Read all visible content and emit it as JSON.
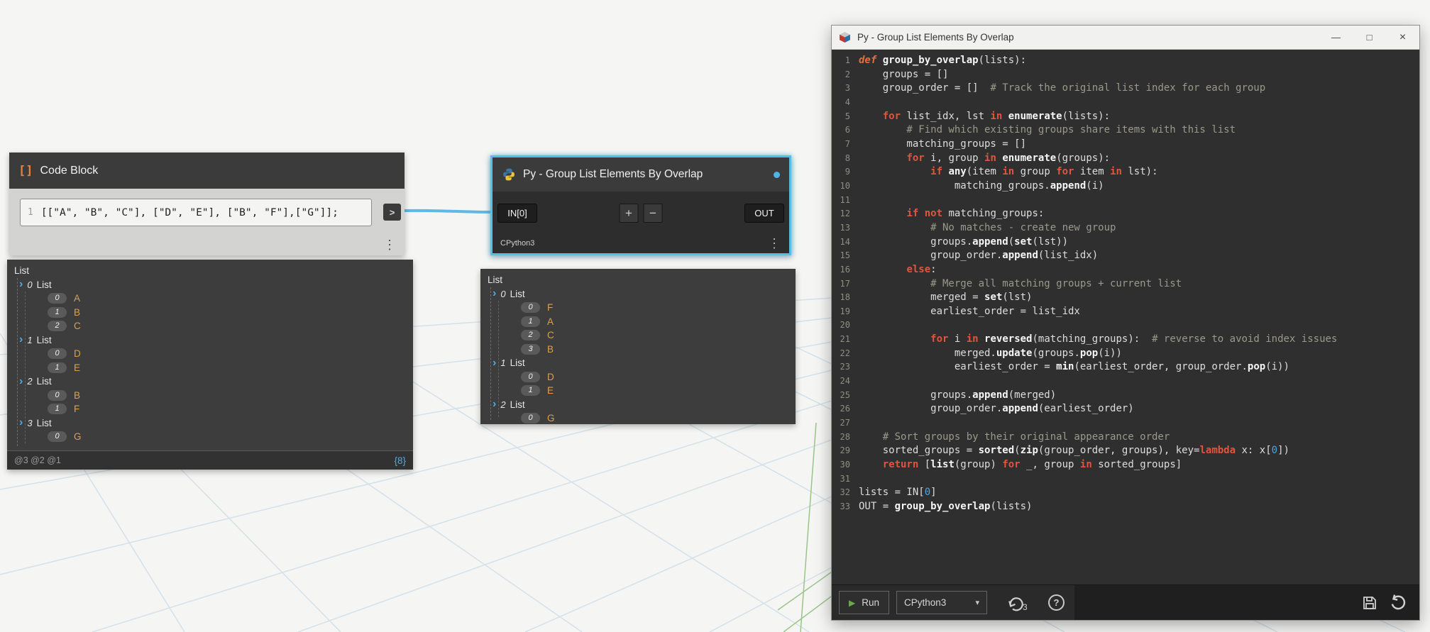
{
  "canvas": {
    "bg": "#f5f5f3",
    "grid_color": "#d3e1ea",
    "axis_color": "#9ac489",
    "wire_color": "#5fb8e6",
    "selection_color": "#58bce8"
  },
  "icons": {
    "tree_chevron": "›",
    "caret_down": "▾",
    "play": "▶",
    "menu": "⋮",
    "value_accent": "#d9a24a"
  },
  "code_block_node": {
    "title": "Code Block",
    "icon": "[]",
    "line_number": "1",
    "code": "[[\"A\", \"B\", \"C\"], [\"D\", \"E\"], [\"B\", \"F\"],[\"G\"]];",
    "output_chevron": ">"
  },
  "python_node": {
    "title": "Py - Group List Elements By Overlap",
    "engine": "CPython3",
    "input_port": "IN[0]",
    "add_label": "+",
    "remove_label": "−",
    "output_port": "OUT"
  },
  "preview_left": {
    "rows": [
      {
        "t": "root",
        "label": "List"
      },
      {
        "t": "list",
        "idx": "0",
        "label": "List"
      },
      {
        "t": "item",
        "idx": "0",
        "val": "A"
      },
      {
        "t": "item",
        "idx": "1",
        "val": "B"
      },
      {
        "t": "item",
        "idx": "2",
        "val": "C"
      },
      {
        "t": "list",
        "idx": "1",
        "label": "List"
      },
      {
        "t": "item",
        "idx": "0",
        "val": "D"
      },
      {
        "t": "item",
        "idx": "1",
        "val": "E"
      },
      {
        "t": "list",
        "idx": "2",
        "label": "List"
      },
      {
        "t": "item",
        "idx": "0",
        "val": "B"
      },
      {
        "t": "item",
        "idx": "1",
        "val": "F"
      },
      {
        "t": "list",
        "idx": "3",
        "label": "List"
      },
      {
        "t": "item",
        "idx": "0",
        "val": "G"
      }
    ],
    "footer_levels": "@3 @2 @1",
    "footer_count": "{8}"
  },
  "preview_right": {
    "rows": [
      {
        "t": "root",
        "label": "List"
      },
      {
        "t": "list",
        "idx": "0",
        "label": "List"
      },
      {
        "t": "item",
        "idx": "0",
        "val": "F"
      },
      {
        "t": "item",
        "idx": "1",
        "val": "A"
      },
      {
        "t": "item",
        "idx": "2",
        "val": "C"
      },
      {
        "t": "item",
        "idx": "3",
        "val": "B"
      },
      {
        "t": "list",
        "idx": "1",
        "label": "List"
      },
      {
        "t": "item",
        "idx": "0",
        "val": "D"
      },
      {
        "t": "item",
        "idx": "1",
        "val": "E"
      },
      {
        "t": "list",
        "idx": "2",
        "label": "List"
      },
      {
        "t": "item",
        "idx": "0",
        "val": "G"
      }
    ]
  },
  "editor": {
    "title": "Py - Group List Elements By Overlap",
    "window": {
      "minimize": "—",
      "maximize": "□",
      "close": "×"
    },
    "toolbar": {
      "run": "Run",
      "engine": "CPython3",
      "migration": "3",
      "help": "?"
    },
    "lines": [
      {
        "n": "1",
        "seg": [
          [
            "kwi",
            "def"
          ],
          [
            "pl",
            " "
          ],
          [
            "fn",
            "group_by_overlap"
          ],
          [
            "pl",
            "(lists):"
          ]
        ]
      },
      {
        "n": "2",
        "seg": [
          [
            "pl",
            "    groups = []"
          ]
        ]
      },
      {
        "n": "3",
        "seg": [
          [
            "pl",
            "    group_order = []  "
          ],
          [
            "com",
            "# Track the original list index for each group"
          ]
        ]
      },
      {
        "n": "4",
        "seg": []
      },
      {
        "n": "5",
        "seg": [
          [
            "pl",
            "    "
          ],
          [
            "kw",
            "for"
          ],
          [
            "pl",
            " list_idx, lst "
          ],
          [
            "kw",
            "in"
          ],
          [
            "pl",
            " "
          ],
          [
            "fn",
            "enumerate"
          ],
          [
            "pl",
            "(lists):"
          ]
        ]
      },
      {
        "n": "6",
        "seg": [
          [
            "com",
            "        # Find which existing groups share items with this list"
          ]
        ]
      },
      {
        "n": "7",
        "seg": [
          [
            "pl",
            "        matching_groups = []"
          ]
        ]
      },
      {
        "n": "8",
        "seg": [
          [
            "pl",
            "        "
          ],
          [
            "kw",
            "for"
          ],
          [
            "pl",
            " i, group "
          ],
          [
            "kw",
            "in"
          ],
          [
            "pl",
            " "
          ],
          [
            "fn",
            "enumerate"
          ],
          [
            "pl",
            "(groups):"
          ]
        ]
      },
      {
        "n": "9",
        "seg": [
          [
            "pl",
            "            "
          ],
          [
            "kw",
            "if"
          ],
          [
            "pl",
            " "
          ],
          [
            "fn",
            "any"
          ],
          [
            "pl",
            "(item "
          ],
          [
            "kw",
            "in"
          ],
          [
            "pl",
            " group "
          ],
          [
            "kw",
            "for"
          ],
          [
            "pl",
            " item "
          ],
          [
            "kw",
            "in"
          ],
          [
            "pl",
            " lst):"
          ]
        ]
      },
      {
        "n": "10",
        "seg": [
          [
            "pl",
            "                matching_groups."
          ],
          [
            "fn",
            "append"
          ],
          [
            "pl",
            "(i)"
          ]
        ]
      },
      {
        "n": "11",
        "seg": []
      },
      {
        "n": "12",
        "seg": [
          [
            "pl",
            "        "
          ],
          [
            "kw",
            "if"
          ],
          [
            "pl",
            " "
          ],
          [
            "kw",
            "not"
          ],
          [
            "pl",
            " matching_groups:"
          ]
        ]
      },
      {
        "n": "13",
        "seg": [
          [
            "com",
            "            # No matches - create new group"
          ]
        ]
      },
      {
        "n": "14",
        "seg": [
          [
            "pl",
            "            groups."
          ],
          [
            "fn",
            "append"
          ],
          [
            "pl",
            "("
          ],
          [
            "fn",
            "set"
          ],
          [
            "pl",
            "(lst))"
          ]
        ]
      },
      {
        "n": "15",
        "seg": [
          [
            "pl",
            "            group_order."
          ],
          [
            "fn",
            "append"
          ],
          [
            "pl",
            "(list_idx)"
          ]
        ]
      },
      {
        "n": "16",
        "seg": [
          [
            "pl",
            "        "
          ],
          [
            "kw",
            "else"
          ],
          [
            "pl",
            ":"
          ]
        ]
      },
      {
        "n": "17",
        "seg": [
          [
            "com",
            "            # Merge all matching groups + current list"
          ]
        ]
      },
      {
        "n": "18",
        "seg": [
          [
            "pl",
            "            merged = "
          ],
          [
            "fn",
            "set"
          ],
          [
            "pl",
            "(lst)"
          ]
        ]
      },
      {
        "n": "19",
        "seg": [
          [
            "pl",
            "            earliest_order = list_idx"
          ]
        ]
      },
      {
        "n": "20",
        "seg": []
      },
      {
        "n": "21",
        "seg": [
          [
            "pl",
            "            "
          ],
          [
            "kw",
            "for"
          ],
          [
            "pl",
            " i "
          ],
          [
            "kw",
            "in"
          ],
          [
            "pl",
            " "
          ],
          [
            "fn",
            "reversed"
          ],
          [
            "pl",
            "(matching_groups):  "
          ],
          [
            "com",
            "# reverse to avoid index issues"
          ]
        ]
      },
      {
        "n": "22",
        "seg": [
          [
            "pl",
            "                merged."
          ],
          [
            "fn",
            "update"
          ],
          [
            "pl",
            "(groups."
          ],
          [
            "fn",
            "pop"
          ],
          [
            "pl",
            "(i))"
          ]
        ]
      },
      {
        "n": "23",
        "seg": [
          [
            "pl",
            "                earliest_order = "
          ],
          [
            "fn",
            "min"
          ],
          [
            "pl",
            "(earliest_order, group_order."
          ],
          [
            "fn",
            "pop"
          ],
          [
            "pl",
            "(i))"
          ]
        ]
      },
      {
        "n": "24",
        "seg": []
      },
      {
        "n": "25",
        "seg": [
          [
            "pl",
            "            groups."
          ],
          [
            "fn",
            "append"
          ],
          [
            "pl",
            "(merged)"
          ]
        ]
      },
      {
        "n": "26",
        "seg": [
          [
            "pl",
            "            group_order."
          ],
          [
            "fn",
            "append"
          ],
          [
            "pl",
            "(earliest_order)"
          ]
        ]
      },
      {
        "n": "27",
        "seg": []
      },
      {
        "n": "28",
        "seg": [
          [
            "com",
            "    # Sort groups by their original appearance order"
          ]
        ]
      },
      {
        "n": "29",
        "seg": [
          [
            "pl",
            "    sorted_groups = "
          ],
          [
            "fn",
            "sorted"
          ],
          [
            "pl",
            "("
          ],
          [
            "fn",
            "zip"
          ],
          [
            "pl",
            "(group_order, groups), key="
          ],
          [
            "kw",
            "lambda"
          ],
          [
            "pl",
            " x: x["
          ],
          [
            "num",
            "0"
          ],
          [
            "pl",
            "])"
          ]
        ]
      },
      {
        "n": "30",
        "seg": [
          [
            "pl",
            "    "
          ],
          [
            "kw",
            "return"
          ],
          [
            "pl",
            " ["
          ],
          [
            "fn",
            "list"
          ],
          [
            "pl",
            "(group) "
          ],
          [
            "kw",
            "for"
          ],
          [
            "pl",
            " _, group "
          ],
          [
            "kw",
            "in"
          ],
          [
            "pl",
            " sorted_groups]"
          ]
        ]
      },
      {
        "n": "31",
        "seg": []
      },
      {
        "n": "32",
        "seg": [
          [
            "pl",
            "lists = IN["
          ],
          [
            "num",
            "0"
          ],
          [
            "pl",
            "]"
          ]
        ]
      },
      {
        "n": "33",
        "seg": [
          [
            "pl",
            "OUT = "
          ],
          [
            "fn",
            "group_by_overlap"
          ],
          [
            "pl",
            "(lists)"
          ]
        ]
      }
    ]
  }
}
